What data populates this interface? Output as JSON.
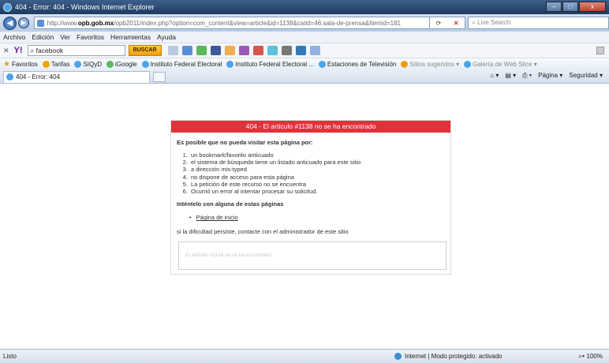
{
  "window": {
    "title": "404 - Error: 404 - Windows Internet Explorer",
    "controls": [
      "–",
      "□",
      "x"
    ]
  },
  "address": {
    "url_prefix": "http://www.",
    "url_host": "opb.gob.mx",
    "url_rest": "/opb2011/index.php?option=com_content&view=article&id=1138&catid=46:sala-de-prensa&Itemid=181",
    "search_placeholder": "Live Search"
  },
  "menu": [
    "Archivo",
    "Edición",
    "Ver",
    "Favoritos",
    "Herramientas",
    "Ayuda"
  ],
  "yahoo": {
    "logo": "Y!",
    "search_value": "facebook",
    "buscar": "BUSCAR"
  },
  "favorites": {
    "label": "Favoritos",
    "items": [
      "Tarifas",
      "SIQyD",
      "iGoogle",
      "Instituto Federal Electoral",
      "Instituto Federal Electoral ...",
      "Estaciones de Televisión",
      "Sitios sugeridos ▾",
      "Galería de Web Slice ▾"
    ]
  },
  "tab": {
    "label": "404 - Error: 404"
  },
  "command": {
    "page": "Página ▾",
    "security": "Seguridad ▾"
  },
  "error": {
    "header": "404 - El artículo #1138 no se ha encontrado",
    "lead": "Es posible que no pueda visitar esta página por:",
    "reasons": [
      "un bookmark/favorito anticuado",
      "el sistema de búsqueda tiene un listado anticuado para este sitio",
      "a dirección mis-typed",
      "no dispone de acceso para esta página",
      "La petición de este recurso no se encuentra",
      "Ocurrió un error al intentar procesar su solicitud."
    ],
    "lead2": "Inténtelo con alguna de estas páginas",
    "link": "Página de inicio",
    "note": "si la dificultad persiste, contacte con el administrador de este sitio",
    "message": "El artículo #1138 no se ha encontrado"
  },
  "status": {
    "left": "Listo",
    "zone": "Internet | Modo protegido: activado",
    "zoom": "100%"
  }
}
